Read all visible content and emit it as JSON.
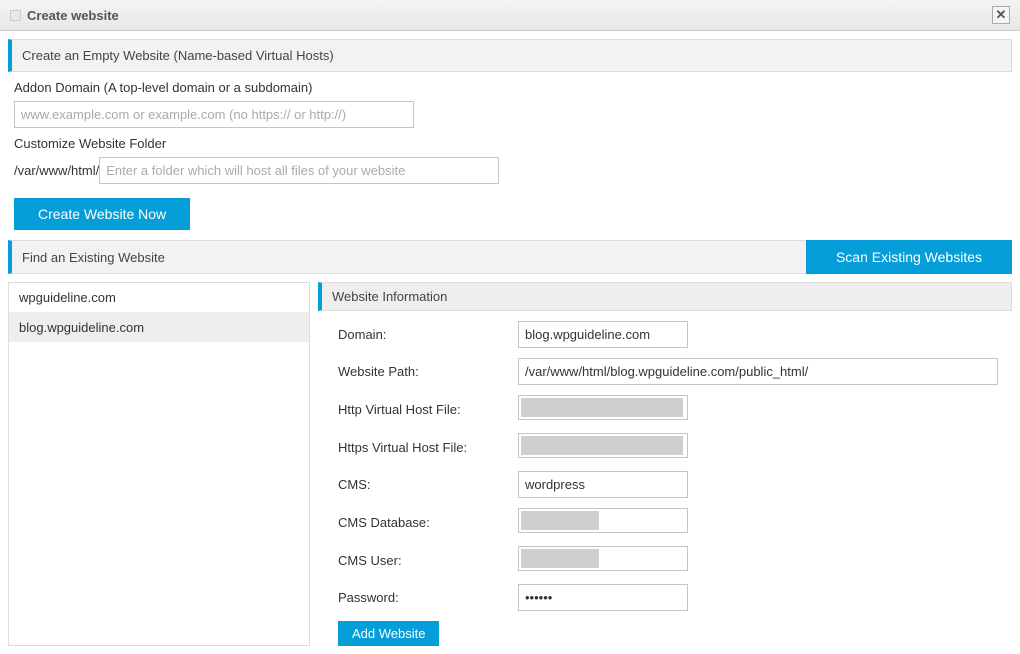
{
  "dialog": {
    "title": "Create website"
  },
  "section1": {
    "title": "Create an Empty Website (Name-based Virtual Hosts)",
    "addon_label": "Addon Domain (A top-level domain or a subdomain)",
    "addon_placeholder": "www.example.com or example.com (no https:// or http://)",
    "folder_label": "Customize Website Folder",
    "folder_prefix": "/var/www/html/",
    "folder_placeholder": "Enter a folder which will host all files of your website",
    "create_btn": "Create Website Now"
  },
  "section2": {
    "title": "Find an Existing Website",
    "scan_btn": "Scan Existing Websites",
    "sites": [
      {
        "name": "wpguideline.com",
        "selected": false
      },
      {
        "name": "blog.wpguideline.com",
        "selected": true
      }
    ]
  },
  "info": {
    "header": "Website Information",
    "rows": {
      "domain_label": "Domain:",
      "domain_value": "blog.wpguideline.com",
      "path_label": "Website Path:",
      "path_value": "/var/www/html/blog.wpguideline.com/public_html/",
      "http_label": "Http Virtual Host File:",
      "https_label": "Https Virtual Host File:",
      "cms_label": "CMS:",
      "cms_value": "wordpress",
      "cmsdb_label": "CMS Database:",
      "cmsuser_label": "CMS User:",
      "password_label": "Password:",
      "password_value": "••••••"
    },
    "add_btn": "Add Website"
  }
}
